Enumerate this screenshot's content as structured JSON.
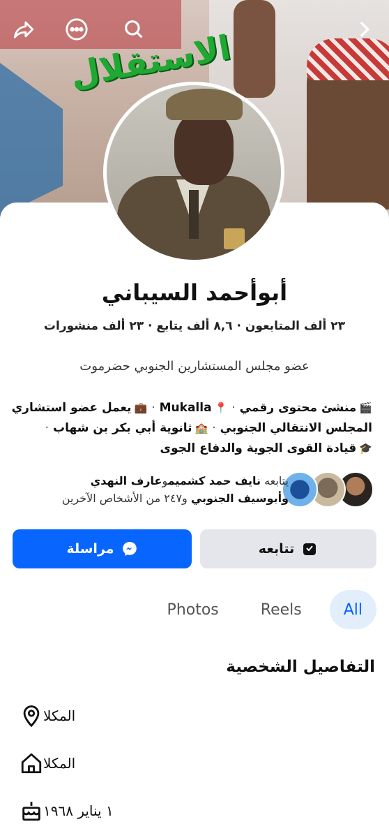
{
  "profile": {
    "name": "أبوأحمد السيباني",
    "stats": "٢٣ ألف المتابعون · ٨,٦ ألف يتابع · ٢٣ ألف منشورات",
    "bio": "عضو مجلس المستشارين الجنوبي حضرموت"
  },
  "details_line": {
    "creator": "منشئ محتوى رقمي",
    "location": "Mukalla",
    "work": "يعمل عضو استشاري",
    "work_place": "المجلس الانتقالي الجنوبي",
    "school": "ثانوية أبي بكر بن شهاب",
    "college": "قيادة القوى الجوية والدفاع الجوى"
  },
  "followers": {
    "prefix": "يتابعه",
    "name1": "نايف حمد كشميم",
    "and1": "و",
    "name2": "عارف النهدي",
    "name3": "وأبوسيف الجنوبي",
    "suffix": "و٢٤٧ من الأشخاص الآخرين"
  },
  "buttons": {
    "follow": "تتابعه",
    "message": "مراسلة"
  },
  "tabs": [
    "All",
    "Reels",
    "Photos"
  ],
  "personal_details": {
    "title": "التفاصيل الشخصية",
    "items": [
      {
        "icon": "location-pin-icon",
        "text": "المكلا"
      },
      {
        "icon": "home-icon",
        "text": "المكلا"
      },
      {
        "icon": "birthday-cake-icon",
        "text": "١ يناير ١٩٦٨"
      }
    ]
  },
  "colors": {
    "accent": "#0866ff",
    "tab_active_bg": "#e3eefc",
    "secondary_button": "#e4e6eb"
  }
}
